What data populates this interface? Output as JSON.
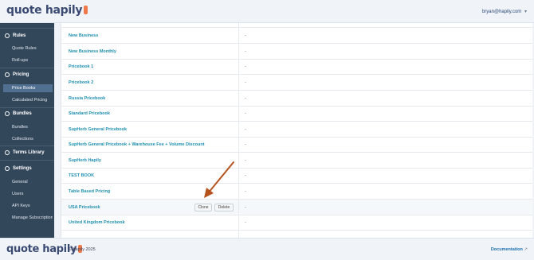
{
  "header": {
    "logo": "quote hapily",
    "user_email": "bryan@hapily.com",
    "caret": "▾"
  },
  "sidebar": {
    "sections": [
      {
        "label": "Rules",
        "items": [
          "Quote Rules",
          "Roll-ups"
        ]
      },
      {
        "label": "Pricing",
        "items": [
          "Price Books",
          "Calculated Pricing"
        ]
      },
      {
        "label": "Bundles",
        "items": [
          "Bundles",
          "Collections"
        ]
      },
      {
        "label": "Terms Library",
        "items": []
      },
      {
        "label": "Settings",
        "items": [
          "General",
          "Users",
          "API Keys",
          "Manage Subscription"
        ]
      }
    ],
    "active_item": "Price Books"
  },
  "pricebooks": [
    {
      "name": "New Business",
      "value": "-"
    },
    {
      "name": "New Business Monthly",
      "value": "-"
    },
    {
      "name": "Pricebook 1",
      "value": "-"
    },
    {
      "name": "Pricebook 2",
      "value": "-"
    },
    {
      "name": "Russia Pricebook",
      "value": "-"
    },
    {
      "name": "Standard Pricebook",
      "value": "-"
    },
    {
      "name": "SupHerb General Pricebook",
      "value": "-"
    },
    {
      "name": "SupHerb General Pricebook + Warehouse Fee + Volume Discount",
      "value": "-"
    },
    {
      "name": "SupHerb Hapily",
      "value": "-"
    },
    {
      "name": "TEST BOOK",
      "value": "-"
    },
    {
      "name": "Table Based Pricing",
      "value": "-"
    },
    {
      "name": "USA Pricebook",
      "value": "-"
    },
    {
      "name": "United Kingdom Pricebook",
      "value": "-"
    }
  ],
  "row_actions": {
    "clone": "Clone",
    "delete": "Delete"
  },
  "colors": {
    "sidebar": "#33475b",
    "active": "#516f90",
    "link": "#1f8fb0",
    "arrow": "#b5531f",
    "brand": "#f0794a"
  },
  "footer": {
    "logo": "quote hapily",
    "copyright": "© hapily 2025",
    "docs_label": "Documentation",
    "ext_icon": "↗"
  }
}
